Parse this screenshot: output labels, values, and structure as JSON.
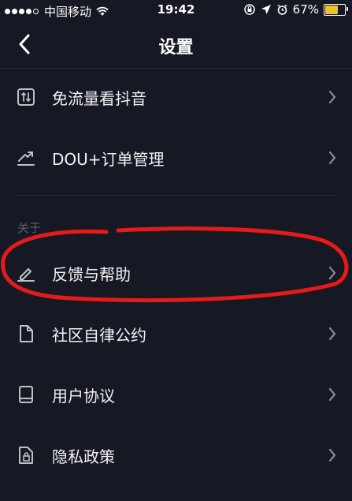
{
  "status_bar": {
    "carrier": "中国移动",
    "time": "19:42",
    "battery_text": "67%",
    "battery_level": 0.67,
    "signal_bars": 4
  },
  "nav": {
    "title": "设置",
    "back_icon": "chevron-left-icon"
  },
  "section_label": "关于",
  "rows": [
    {
      "label": "免流量看抖音",
      "icon": "data-saver-icon"
    },
    {
      "label": "DOU+订单管理",
      "icon": "trend-icon"
    },
    {
      "label": "反馈与帮助",
      "icon": "pencil-icon"
    },
    {
      "label": "社区自律公约",
      "icon": "document-icon"
    },
    {
      "label": "用户协议",
      "icon": "book-icon"
    },
    {
      "label": "隐私政策",
      "icon": "lock-folder-icon"
    }
  ],
  "colors": {
    "background": "#161823",
    "annotation": "#e51a1a",
    "battery": "#f0c420"
  }
}
